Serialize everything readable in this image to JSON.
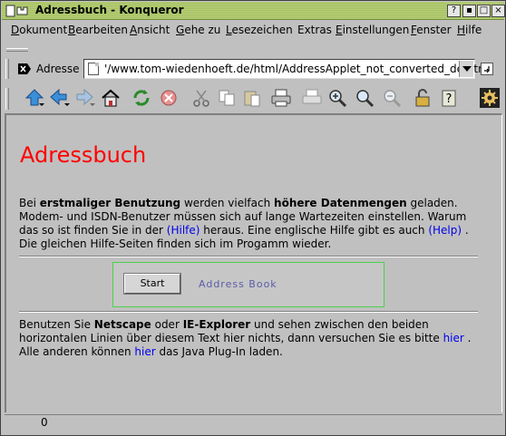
{
  "window": {
    "title": "Adressbuch - Konqueror",
    "buttons": {
      "help": "?",
      "minimize": "▪",
      "maximize": "□",
      "close": "×"
    }
  },
  "menu": {
    "items": [
      {
        "u": "D",
        "rest": "okument"
      },
      {
        "u": "B",
        "rest": "earbeiten"
      },
      {
        "u": "A",
        "rest": "nsicht"
      },
      {
        "u": "G",
        "rest": "ehe zu"
      },
      {
        "u": "L",
        "rest": "esezeichen"
      },
      {
        "u": "",
        "rest": "Extras"
      },
      {
        "u": "E",
        "rest": "instellungen"
      },
      {
        "u": "F",
        "rest": "enster"
      },
      {
        "u": "H",
        "rest": "ilfe"
      }
    ]
  },
  "location": {
    "label": "Adresse",
    "url": "'/www.tom-wiedenhoeft.de/html/AddressApplet_not_converted_de.html"
  },
  "toolbar": {
    "icons": [
      "up-arrow-icon",
      "back-arrow-icon",
      "forward-arrow-icon",
      "home-icon",
      "reload-icon",
      "stop-icon",
      "cut-icon",
      "copy-icon",
      "paste-icon",
      "print-icon",
      "print-frame-icon",
      "zoom-in-icon",
      "zoom-icon",
      "zoom-out-icon",
      "security-lock-icon",
      "help-icon",
      "konqueror-gear-icon"
    ]
  },
  "page": {
    "heading": "Adressbuch",
    "intro": {
      "t1": "Bei ",
      "b1": "erstmaliger Benutzung",
      "t2": " werden vielfach ",
      "b2": "höhere Datenmengen",
      "t3": " geladen. Modem- und ISDN-Benutzer müssen sich auf lange Wartezeiten einstellen. Warum das so ist finden Sie in der ",
      "link1": "(Hilfe)",
      "t4": " heraus. Eine englische Hilfe gibt es auch ",
      "link2": "(Help)",
      "t5": " .  Die gleichen Hilfe-Seiten finden sich im Progamm wieder."
    },
    "applet": {
      "start_label": "Start",
      "title": "Address Book"
    },
    "outro": {
      "t1": "Benutzen Sie ",
      "b1": "Netscape",
      "t2": " oder ",
      "b2": "IE-Explorer",
      "t3": " und sehen zwischen den beiden horizontalen Linien über diesem Text hier nichts, dann versuchen Sie es bitte ",
      "link1": "hier",
      "t4": " . Alle anderen können ",
      "link2": "hier",
      "t5": " das Java Plug-In laden."
    }
  },
  "status": {
    "text": "0"
  }
}
